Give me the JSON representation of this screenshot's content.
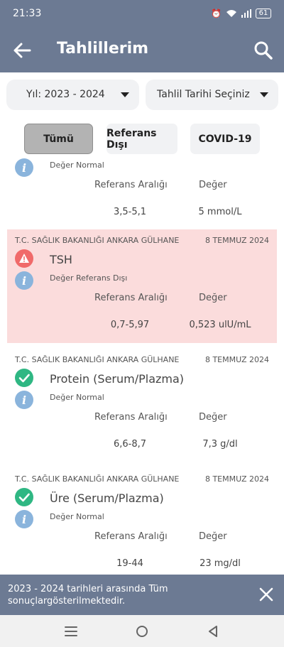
{
  "status_bar": {
    "time": "21:33",
    "battery": "61"
  },
  "app_bar": {
    "title": "Tahlillerim"
  },
  "filters": {
    "year": "Yıl: 2023 - 2024",
    "date": "Tahlil Tarihi Seçiniz"
  },
  "chips": [
    "Tümü",
    "Referans Dışı",
    "COVID-19"
  ],
  "active_chip": "Tümü",
  "column_headers": {
    "range": "Referans Aralığı",
    "value": "Değer"
  },
  "results": [
    {
      "hospital": "",
      "date": "",
      "name": "",
      "status": "normal",
      "note": "Değer Normal",
      "range": "3,5-5,1",
      "value": "5 mmol/L"
    },
    {
      "hospital": "T.C. SAĞLIK BAKANLIĞI ANKARA GÜLHANE",
      "date": "8 TEMMUZ 2024",
      "name": "TSH",
      "status": "out-of-range",
      "note": "Değer Referans Dışı",
      "range": "0,7-5,97",
      "value": "0,523 ulU/mL"
    },
    {
      "hospital": "T.C. SAĞLIK BAKANLIĞI ANKARA GÜLHANE",
      "date": "8 TEMMUZ 2024",
      "name": "Protein (Serum/Plazma)",
      "status": "normal",
      "note": "Değer Normal",
      "range": "6,6-8,7",
      "value": "7,3 g/dl"
    },
    {
      "hospital": "T.C. SAĞLIK BAKANLIĞI ANKARA GÜLHANE",
      "date": "8 TEMMUZ 2024",
      "name": "Üre (Serum/Plazma)",
      "status": "normal",
      "note": "Değer Normal",
      "range": "19-44",
      "value": "23 mg/dl"
    }
  ],
  "snackbar": {
    "message": "2023 - 2024 tarihleri arasında Tüm sonuçlargösterilmektedir."
  },
  "colors": {
    "header": "#6c7a93",
    "alert_bg": "#fbdcdc",
    "ok_green": "#2fb783",
    "warn_red": "#f06a6a",
    "info_blue": "#8ab4dc"
  }
}
